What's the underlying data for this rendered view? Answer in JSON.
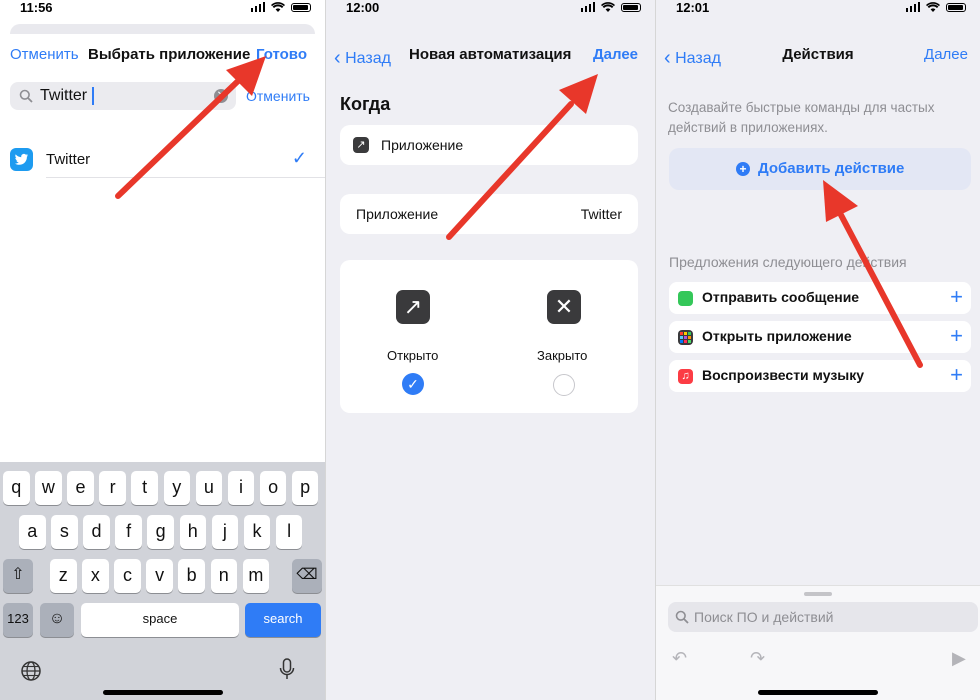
{
  "screen1": {
    "time": "11:56",
    "nav": {
      "cancel": "Отменить",
      "title": "Выбрать приложение",
      "done": "Готово"
    },
    "search": {
      "query": "Twitter",
      "cancel": "Отменить",
      "search_icon": "magnifier-icon",
      "clear_icon": "clear-icon"
    },
    "app_row": {
      "name": "Twitter",
      "selected": true
    },
    "keyboard": {
      "row1": [
        "q",
        "w",
        "e",
        "r",
        "t",
        "y",
        "u",
        "i",
        "o",
        "p"
      ],
      "row2": [
        "a",
        "s",
        "d",
        "f",
        "g",
        "h",
        "j",
        "k",
        "l"
      ],
      "row3": [
        "z",
        "x",
        "c",
        "v",
        "b",
        "n",
        "m"
      ],
      "numbers_key": "123",
      "space_key": "space",
      "search_key": "search",
      "shift_icon": "shift-icon",
      "backspace_icon": "backspace-icon",
      "emoji_icon": "emoji-icon",
      "globe_icon": "globe-icon",
      "mic_icon": "microphone-icon"
    }
  },
  "screen2": {
    "time": "12:00",
    "nav": {
      "back": "Назад",
      "title": "Новая автоматизация",
      "next": "Далее"
    },
    "section_title": "Когда",
    "trigger_label": "Приложение",
    "app_setting": {
      "label": "Приложение",
      "value": "Twitter"
    },
    "options": [
      {
        "label": "Открыто",
        "icon": "open-arrow-icon",
        "checked": true
      },
      {
        "label": "Закрыто",
        "icon": "close-x-icon",
        "checked": false
      }
    ]
  },
  "screen3": {
    "time": "12:01",
    "nav": {
      "back": "Назад",
      "title": "Действия",
      "next": "Далее"
    },
    "hint": "Создавайте быстрые команды для частых действий в приложениях.",
    "add_action": "Добавить действие",
    "suggestions_title": "Предложения следующего действия",
    "suggestions": [
      {
        "label": "Отправить сообщение",
        "icon": "messages-icon",
        "color": "#34c759"
      },
      {
        "label": "Открыть приложение",
        "icon": "apps-grid-icon",
        "color": "#3a3a3c"
      },
      {
        "label": "Воспроизвести музыку",
        "icon": "music-icon",
        "color": "#fc3c44"
      }
    ],
    "search_placeholder": "Поиск ПО и действий",
    "toolbar_icons": [
      "undo-icon",
      "redo-icon",
      "play-icon"
    ]
  },
  "colors": {
    "accent": "#2f7cf6",
    "arrow": "#e8372a",
    "twitter": "#1d9bf0"
  }
}
